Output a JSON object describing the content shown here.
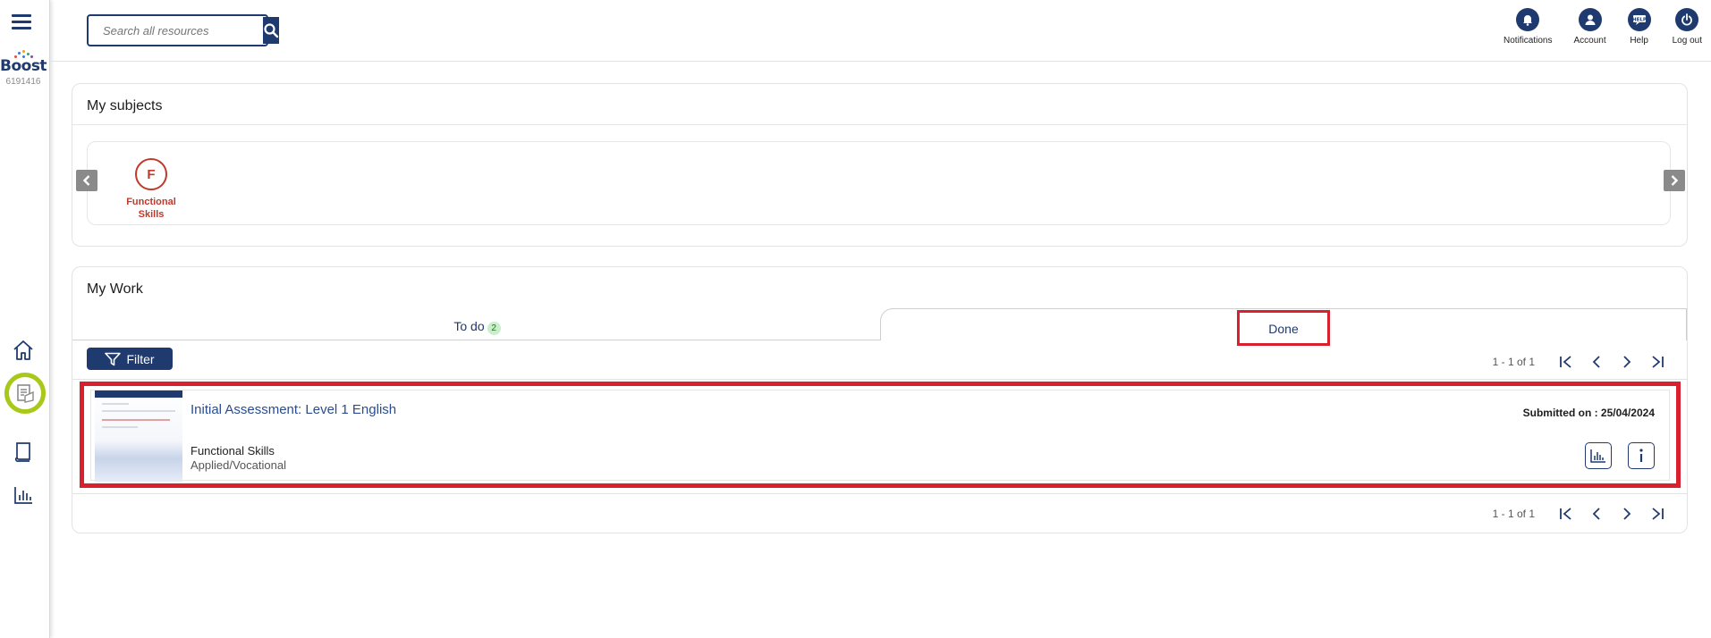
{
  "rail": {
    "logo_text": "Boost",
    "logo_id": "6191416",
    "items": [
      {
        "icon": "home-icon"
      },
      {
        "icon": "assignment-icon",
        "active": true
      },
      {
        "icon": "book-icon"
      },
      {
        "icon": "bar-chart-icon"
      }
    ]
  },
  "header": {
    "search_placeholder": "Search all resources",
    "actions": [
      {
        "label": "Notifications",
        "icon": "bell-icon"
      },
      {
        "label": "Account",
        "icon": "account-icon"
      },
      {
        "label": "Help",
        "icon": "help-icon"
      },
      {
        "label": "Log out",
        "icon": "power-icon"
      }
    ]
  },
  "subjects": {
    "title": "My subjects",
    "items": [
      {
        "letter": "F",
        "label_line1": "Functional",
        "label_line2": "Skills"
      }
    ]
  },
  "work": {
    "title": "My Work",
    "tabs": {
      "todo_label": "To do",
      "todo_count": "2",
      "done_label": "Done"
    },
    "filter_label": "Filter",
    "pager_text": "1 - 1 of 1",
    "items": [
      {
        "title": "Initial Assessment: Level 1 English",
        "subject": "Functional Skills",
        "category": "Applied/Vocational",
        "submitted": "Submitted on : 25/04/2024"
      }
    ]
  },
  "colors": {
    "primary": "#1f3a6e",
    "accent_green": "#a8c91a",
    "subject_red": "#c0392b",
    "highlight_red": "#d9202f"
  }
}
